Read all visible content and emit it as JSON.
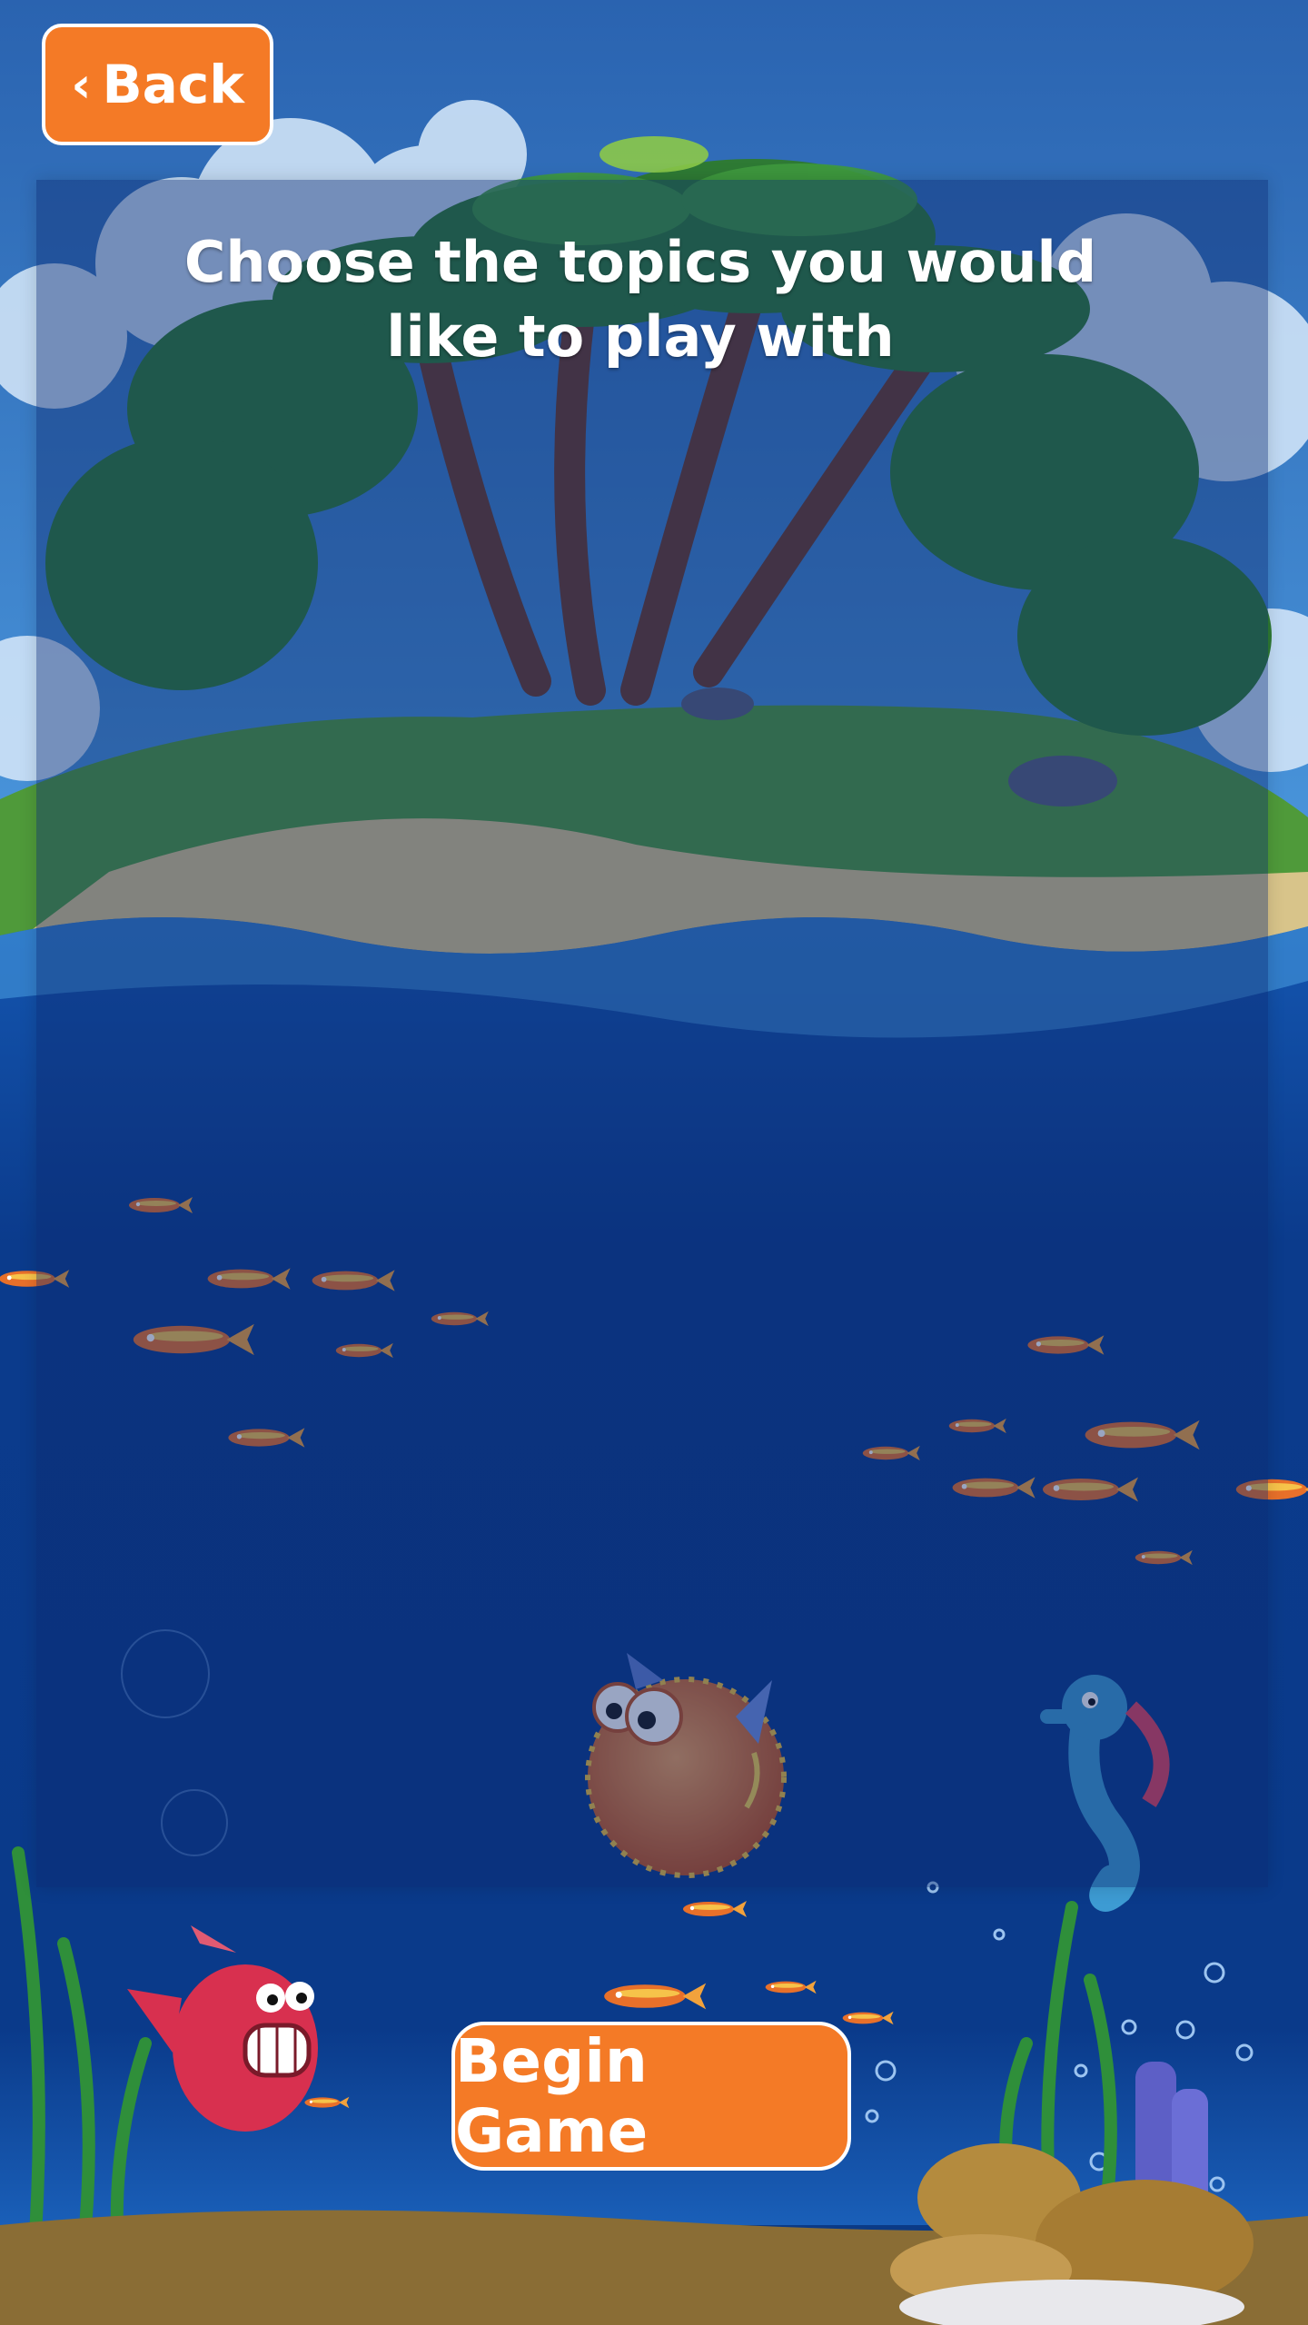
{
  "header": {
    "back_label": "Back"
  },
  "main": {
    "title": "Choose the topics you would like to play with",
    "begin_label": "Begin Game"
  },
  "colors": {
    "accent": "#f47a26",
    "sky": "#2f7fd0",
    "water": "#0c3f92",
    "sand": "#8a6d35"
  },
  "icons": [
    "chevron-left-icon",
    "puffer-fish",
    "seahorse",
    "grinning-fish",
    "small-fish-school",
    "seaweed",
    "rocks",
    "coral",
    "bubbles",
    "palm-island"
  ]
}
